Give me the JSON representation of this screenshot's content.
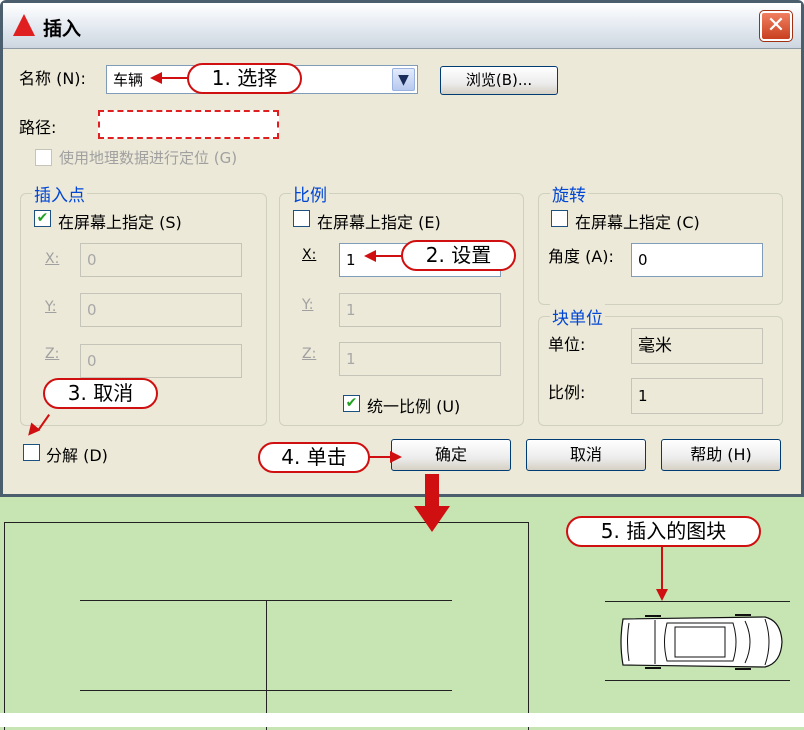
{
  "dialog": {
    "title": "插入",
    "name_label": "名称 (N):",
    "name_value": "车辆",
    "browse_label": "浏览(B)...",
    "path_label": "路径:",
    "geo_label": "使用地理数据进行定位 (G)",
    "insertion": {
      "legend": "插入点",
      "onscreen_label": "在屏幕上指定 (S)",
      "onscreen_checked": true,
      "x_label": "X:",
      "x_value": "0",
      "y_label": "Y:",
      "y_value": "0",
      "z_label": "Z:",
      "z_value": "0"
    },
    "scale": {
      "legend": "比例",
      "onscreen_label": "在屏幕上指定 (E)",
      "x_label": "X:",
      "x_value": "1",
      "y_label": "Y:",
      "y_value": "1",
      "z_label": "Z:",
      "z_value": "1",
      "uniform_label": "统一比例 (U)",
      "uniform_checked": true
    },
    "rotation": {
      "legend": "旋转",
      "onscreen_label": "在屏幕上指定 (C)",
      "angle_label": "角度 (A):",
      "angle_value": "0"
    },
    "block_unit": {
      "legend": "块单位",
      "unit_label": "单位:",
      "unit_value": "毫米",
      "factor_label": "比例:",
      "factor_value": "1"
    },
    "explode_label": "分解 (D)",
    "ok_label": "确定",
    "cancel_label": "取消",
    "help_label": "帮助 (H)"
  },
  "callouts": {
    "c1": "1. 选择",
    "c2": "2. 设置",
    "c3": "3. 取消",
    "c4": "4. 单击",
    "c5": "5. 插入的图块"
  },
  "colors": {
    "accent": "#d01010",
    "legend": "#0046d5",
    "drawing_bg": "#c7e5b3",
    "dialog_bg": "#ece9d8"
  }
}
